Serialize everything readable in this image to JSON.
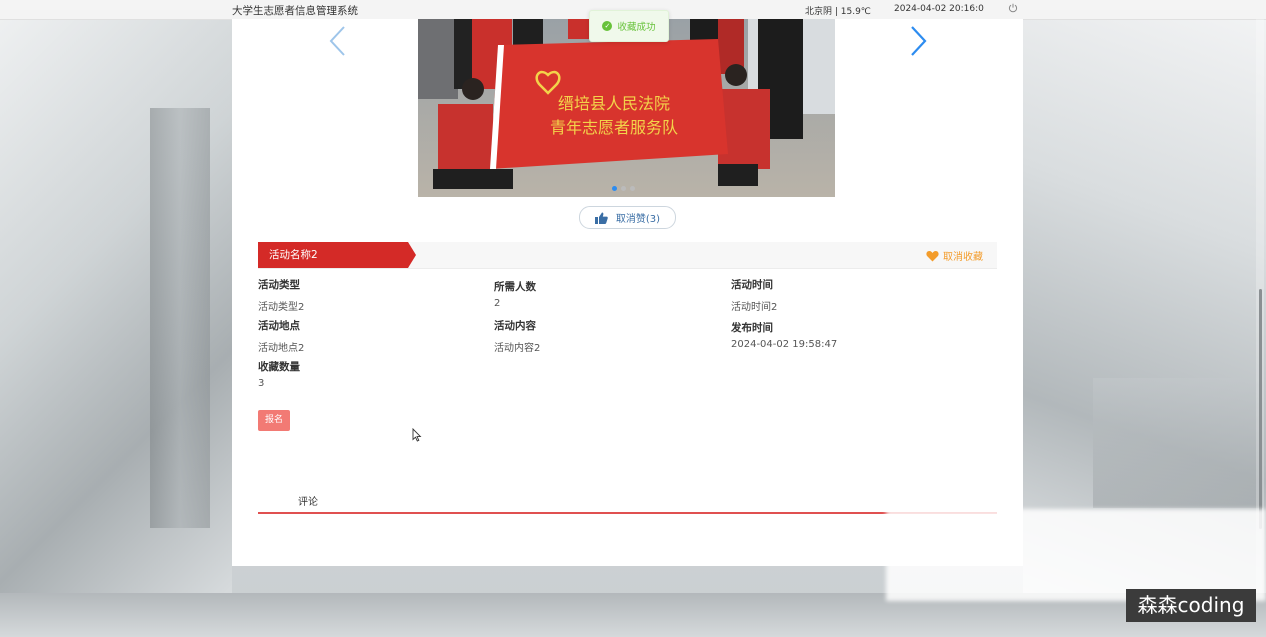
{
  "topbar": {
    "system_title": "大学生志愿者信息管理系统",
    "weather": "北京阴 | 15.9℃",
    "datetime": "2024-04-02   20:16:0"
  },
  "toast": {
    "message": "收藏成功"
  },
  "banner": {
    "flag_line1": "缙培县人民法院",
    "flag_line2": "青年志愿者服务队",
    "slide_count": 3,
    "active_slide": 1
  },
  "like": {
    "label": "取消赞(3)"
  },
  "activity": {
    "name": "活动名称2",
    "collect_label": "取消收藏",
    "fields": {
      "type_label": "活动类型",
      "type_value": "活动类型2",
      "people_label": "所需人数",
      "people_value": "2",
      "time_label": "活动时间",
      "time_value": "活动时间2",
      "place_label": "活动地点",
      "place_value": "活动地点2",
      "content_label": "活动内容",
      "content_value": "活动内容2",
      "publish_label": "发布时间",
      "publish_value": "2024-04-02 19:58:47",
      "fav_label": "收藏数量",
      "fav_value": "3"
    },
    "signup_label": "报名"
  },
  "comments": {
    "tab_label": "评论"
  },
  "watermark": "森森coding",
  "colors": {
    "accent_red": "#d42a27",
    "orange": "#f39c2b",
    "blue": "#2d8cf0",
    "toast_green": "#67c23a"
  },
  "icons": [
    "power-icon",
    "chevron-left-icon",
    "chevron-right-icon",
    "check-circle-icon",
    "thumbs-up-icon",
    "heart-icon",
    "mouse-cursor-icon"
  ]
}
